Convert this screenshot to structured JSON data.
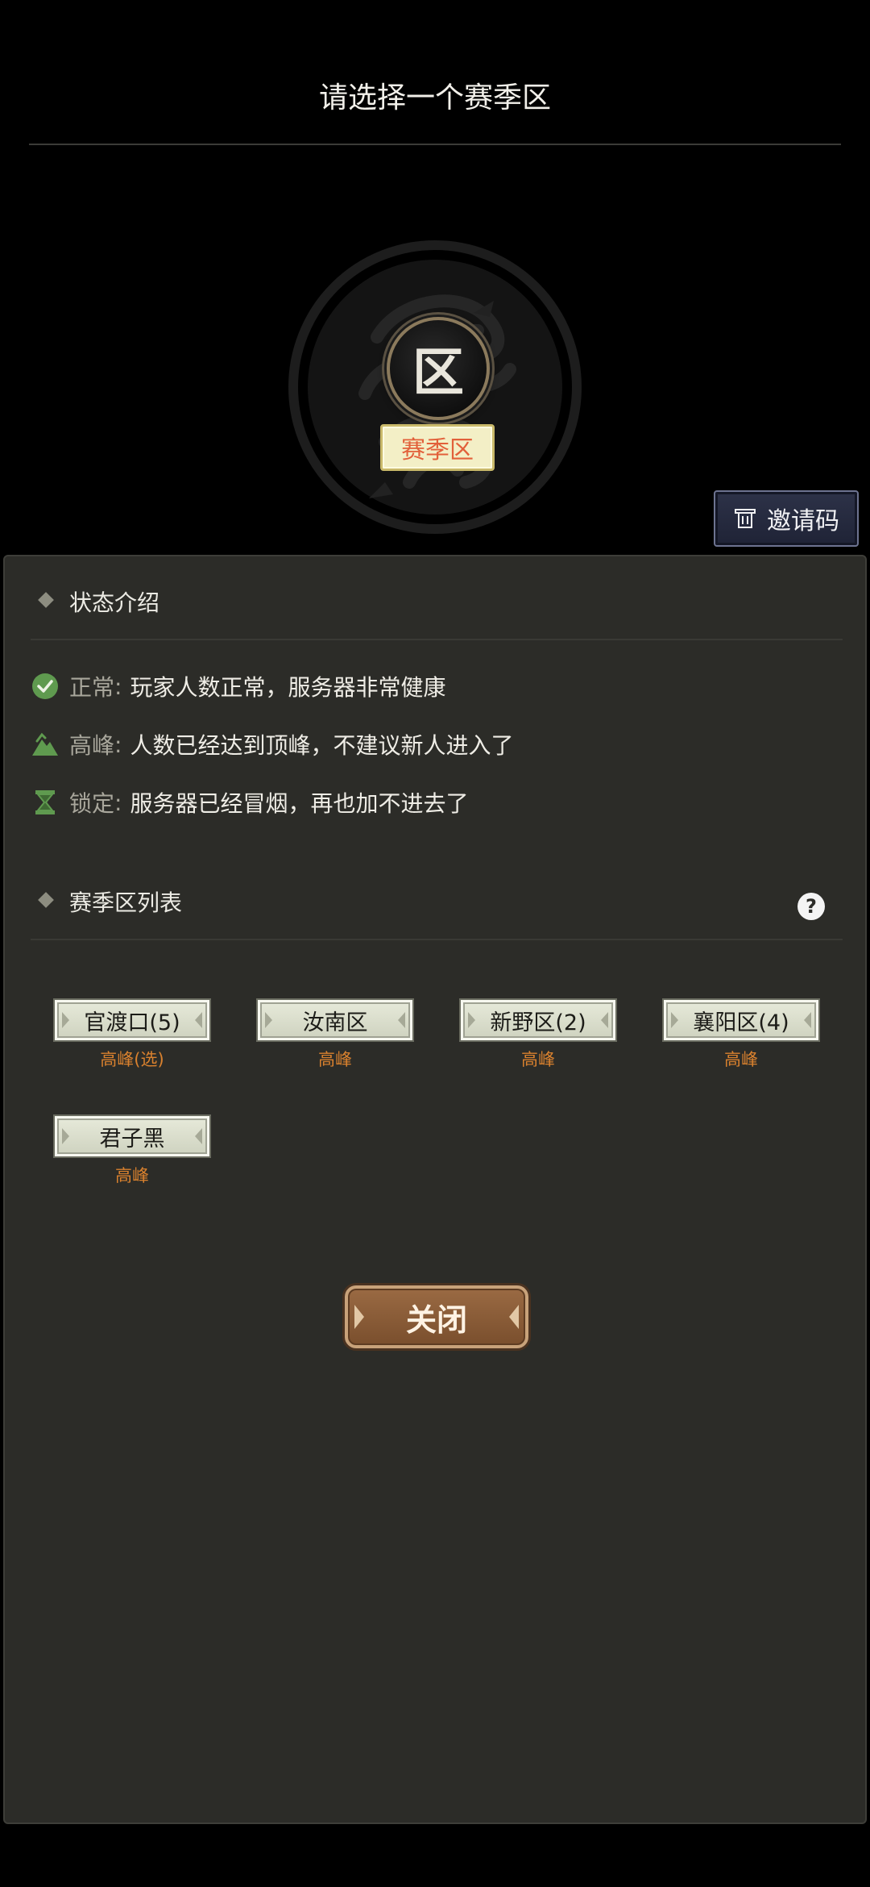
{
  "header": {
    "title": "请选择一个赛季区"
  },
  "zone": {
    "token_char": "区",
    "tag_label": "赛季区"
  },
  "invite": {
    "label": "邀请码"
  },
  "status_section": {
    "heading": "状态介绍",
    "items": [
      {
        "icon": "check-circle-icon",
        "key": "正常",
        "colon": ":",
        "desc": "玩家人数正常，服务器非常健康",
        "color": "#5f9a4f"
      },
      {
        "icon": "peak-mountain-icon",
        "key": "高峰",
        "colon": ":",
        "desc": "人数已经达到顶峰，不建议新人进入了",
        "color": "#5f9a4f"
      },
      {
        "icon": "hourglass-lock-icon",
        "key": "锁定",
        "colon": ":",
        "desc": "服务器已经冒烟，再也加不进去了",
        "color": "#5f9a4f"
      }
    ]
  },
  "server_section": {
    "heading": "赛季区列表",
    "help_glyph": "?",
    "servers": [
      {
        "name": "官渡口(5)",
        "state": "高峰(选)"
      },
      {
        "name": "汝南区",
        "state": "高峰"
      },
      {
        "name": "新野区(2)",
        "state": "高峰"
      },
      {
        "name": "襄阳区(4)",
        "state": "高峰"
      },
      {
        "name": "君子黑",
        "state": "高峰"
      }
    ]
  },
  "footer": {
    "close_label": "关闭"
  },
  "colors": {
    "accent_orange": "#d9812e",
    "tag_text": "#e2603a",
    "panel_bg": "#2c2c28"
  }
}
